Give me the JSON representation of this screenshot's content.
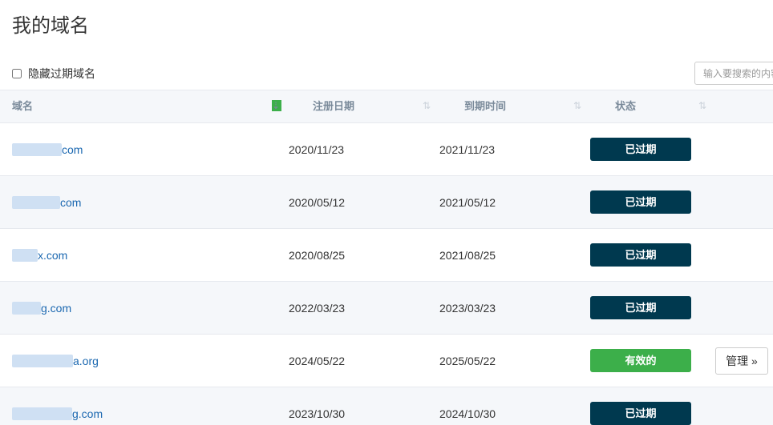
{
  "page": {
    "title": "我的域名"
  },
  "filter": {
    "hide_expired_label": "隐藏过期域名",
    "hide_expired_checked": false
  },
  "search": {
    "placeholder": "输入要搜索的内容"
  },
  "table": {
    "columns": [
      "域名",
      "注册日期",
      "到期时间",
      "状态"
    ],
    "rows": [
      {
        "domain": "com",
        "registered": "2020/11/23",
        "expires": "2021/11/23",
        "status": "已过期",
        "status_type": "expired"
      },
      {
        "domain": "com",
        "registered": "2020/05/12",
        "expires": "2021/05/12",
        "status": "已过期",
        "status_type": "expired"
      },
      {
        "domain": "x.com",
        "registered": "2020/08/25",
        "expires": "2021/08/25",
        "status": "已过期",
        "status_type": "expired"
      },
      {
        "domain": "g.com",
        "registered": "2022/03/23",
        "expires": "2023/03/23",
        "status": "已过期",
        "status_type": "expired"
      },
      {
        "domain": "a.org",
        "registered": "2024/05/22",
        "expires": "2025/05/22",
        "status": "有效的",
        "status_type": "active",
        "manage": "管理 »"
      },
      {
        "domain": "g.com",
        "registered": "2023/10/30",
        "expires": "2024/10/30",
        "status": "已过期",
        "status_type": "expired"
      }
    ]
  },
  "colors": {
    "expired": "#00394f",
    "active": "#3caf4a",
    "link": "#1a67b0"
  }
}
